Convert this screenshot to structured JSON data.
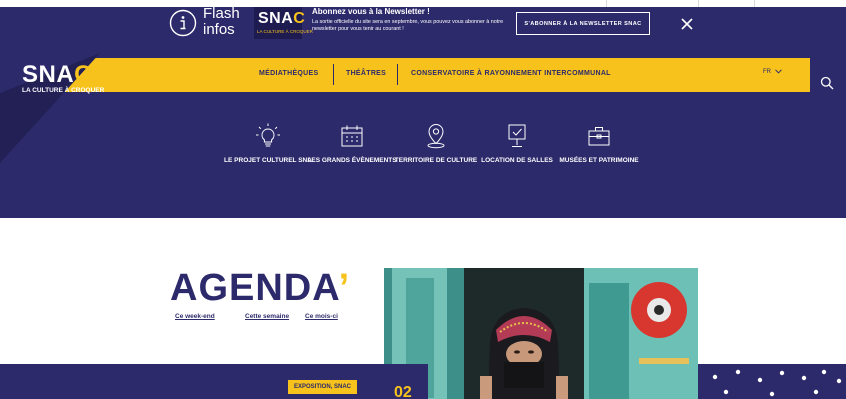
{
  "flash": {
    "title": "Flash infos",
    "logo": {
      "word": "SNA",
      "word_accent": "C",
      "tagline": "LA CULTURE À CROQUER"
    },
    "newsletter_title": "Abonnez vous à la Newsletter !",
    "newsletter_body": "La sortie officielle du site sera en septembre, vous pouvez vous abonner à notre newsletter pour vous tenir au courant !",
    "subscribe_label": "S'ABONNER À LA NEWSLETTER SNAC",
    "close_icon": "close-icon"
  },
  "header": {
    "logo": {
      "word": "SNA",
      "word_accent": "C",
      "tagline": "LA CULTURE À CROQUER"
    },
    "nav": [
      "MÉDIATHÈQUES",
      "THÉÂTRES",
      "CONSERVATOIRE À RAYONNEMENT INTERCOMMUNAL"
    ],
    "lang": "FR",
    "search_icon": "search-icon"
  },
  "icon_menu": [
    {
      "icon": "lightbulb-icon",
      "label": "LE PROJET CULTUREL SNA"
    },
    {
      "icon": "calendar-icon",
      "label": "LES GRANDS ÉVÈNEMENTS"
    },
    {
      "icon": "map-pin-icon",
      "label": "TERRITOIRE DE CULTURE"
    },
    {
      "icon": "screen-check-icon",
      "label": "LOCATION DE SALLES"
    },
    {
      "icon": "briefcase-icon",
      "label": "MUSÉES ET PATRIMOINE"
    }
  ],
  "agenda": {
    "title": "AGENDA",
    "title_accent": "’",
    "links": [
      "Ce week-end",
      "Cette semaine",
      "Ce mois-ci"
    ]
  },
  "featured": {
    "badge": "EXPOSITION, SNAC",
    "date": "02"
  },
  "colors": {
    "navy": "#2d2a6b",
    "yellow": "#f6c21b",
    "white": "#ffffff"
  }
}
